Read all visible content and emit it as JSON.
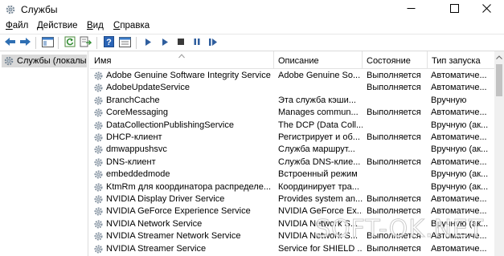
{
  "window": {
    "title": "Службы",
    "icon": "gear-icon",
    "controls": [
      "minimize-icon",
      "maximize-icon",
      "close-icon"
    ]
  },
  "menu": {
    "file": {
      "accel": "Ф",
      "rest": "айл"
    },
    "action": {
      "accel": "Д",
      "rest": "ействие"
    },
    "view": {
      "accel": "В",
      "rest": "ид"
    },
    "help": {
      "accel": "С",
      "rest": "правка"
    }
  },
  "toolbar": {
    "icons": [
      "back-icon",
      "forward-icon",
      "console-tree-icon",
      "refresh-icon",
      "export-list-icon",
      "help-icon",
      "properties-icon",
      "start-service-icon",
      "start-service-alt-icon",
      "stop-service-icon",
      "pause-service-icon",
      "restart-service-icon"
    ]
  },
  "tree": {
    "item_label": "Службы (локалы"
  },
  "columns": {
    "name": "Имя",
    "description": "Описание",
    "state": "Состояние",
    "startup": "Тип запуска"
  },
  "services": [
    {
      "name": "Adobe Genuine Software Integrity Service",
      "description": "Adobe Genuine So...",
      "state": "Выполняется",
      "startup": "Автоматиче..."
    },
    {
      "name": "AdobeUpdateService",
      "description": "",
      "state": "Выполняется",
      "startup": "Автоматиче..."
    },
    {
      "name": "BranchCache",
      "description": "Эта служба кэши...",
      "state": "",
      "startup": "Вручную"
    },
    {
      "name": "CoreMessaging",
      "description": "Manages commun...",
      "state": "Выполняется",
      "startup": "Автоматиче..."
    },
    {
      "name": "DataCollectionPublishingService",
      "description": "The DCP (Data Coll...",
      "state": "",
      "startup": "Вручную (ак..."
    },
    {
      "name": "DHCP-клиент",
      "description": "Регистрирует и об...",
      "state": "Выполняется",
      "startup": "Автоматиче..."
    },
    {
      "name": "dmwappushsvc",
      "description": "Служба маршрут...",
      "state": "",
      "startup": "Вручную (ак..."
    },
    {
      "name": "DNS-клиент",
      "description": "Служба DNS-клие...",
      "state": "Выполняется",
      "startup": "Автоматиче..."
    },
    {
      "name": "embeddedmode",
      "description": "Встроенный режим",
      "state": "",
      "startup": "Вручную (ак..."
    },
    {
      "name": "KtmRm для координатора распределе...",
      "description": "Координирует тра...",
      "state": "",
      "startup": "Вручную (ак..."
    },
    {
      "name": "NVIDIA Display Driver Service",
      "description": "Provides system an...",
      "state": "Выполняется",
      "startup": "Автоматиче..."
    },
    {
      "name": "NVIDIA GeForce Experience Service",
      "description": "NVIDIA GeForce Ex...",
      "state": "Выполняется",
      "startup": "Автоматиче..."
    },
    {
      "name": "NVIDIA Network Service",
      "description": "NVIDIA Network S...",
      "state": "",
      "startup": "Вручную (ак..."
    },
    {
      "name": "NVIDIA Streamer Network Service",
      "description": "NVIDIA Network S...",
      "state": "Выполняется",
      "startup": "Автоматиче..."
    },
    {
      "name": "NVIDIA Streamer Service",
      "description": "Service for SHIELD ...",
      "state": "Выполняется",
      "startup": "Автоматиче..."
    }
  ],
  "watermark": "SOFT-OK.NET"
}
